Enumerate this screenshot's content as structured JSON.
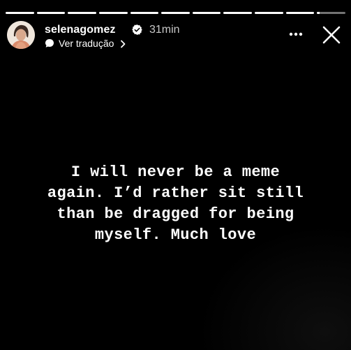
{
  "story": {
    "progress": [
      1,
      1,
      1,
      1,
      1,
      1,
      1,
      1,
      1,
      1,
      0.1
    ],
    "user": {
      "username": "selenagomez",
      "verified": true,
      "time": "31min",
      "avatar_icon": "profile-photo"
    },
    "translate": {
      "label": "Ver tradução",
      "icon": "translate-bubble-icon",
      "chevron": "chevron-right-icon"
    },
    "actions": {
      "more_icon": "more-horizontal-icon",
      "close_icon": "close-icon"
    },
    "text": {
      "lines": [
        "I will never be a meme",
        "again. I’d rather sit still",
        "than be dragged for being",
        "myself. Much love"
      ]
    },
    "colors": {
      "background": "#000000",
      "text": "#ffffff",
      "verified": "#ffffff",
      "progress_track": "rgba(255,255,255,0.45)",
      "progress_fill": "#ffffff"
    }
  }
}
